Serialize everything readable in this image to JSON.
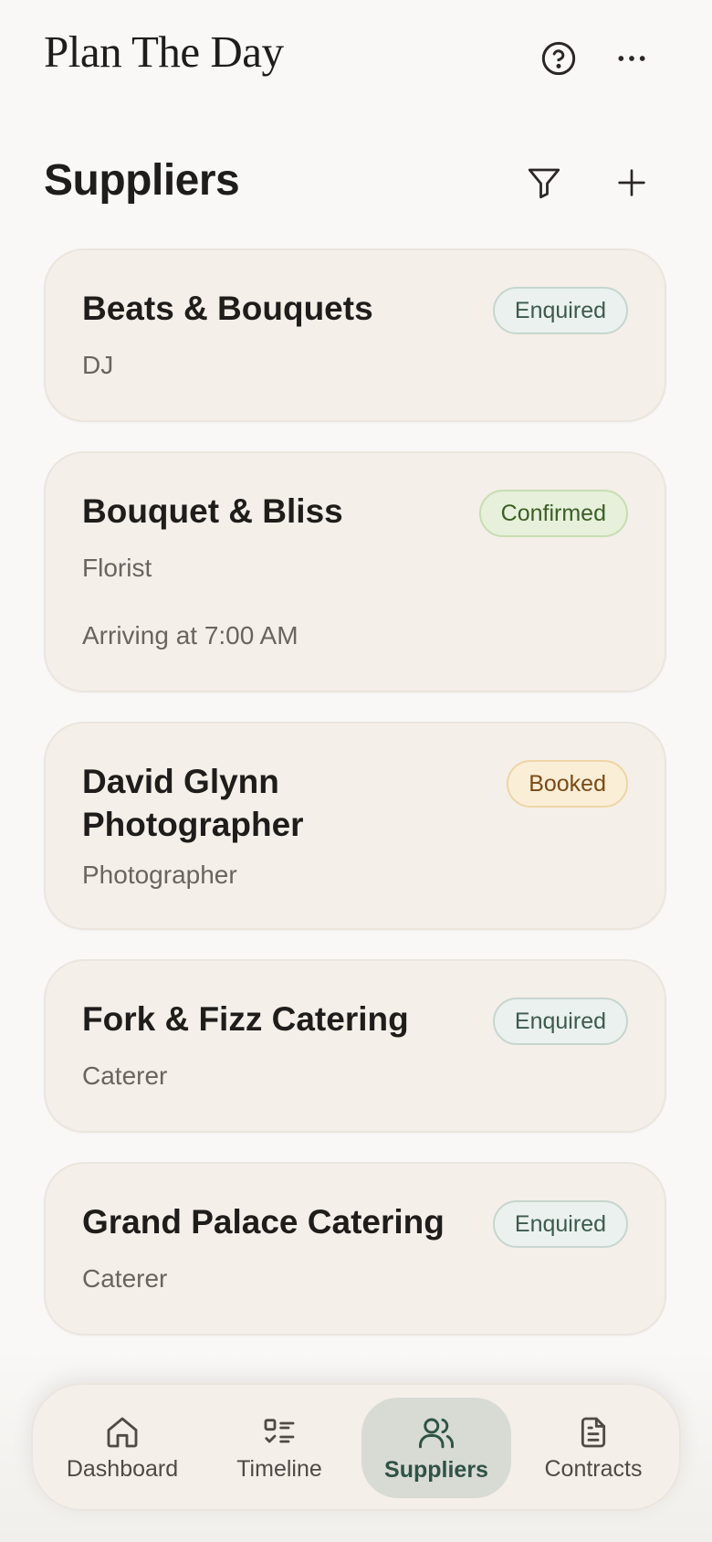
{
  "app": {
    "title": "Plan The Day"
  },
  "section": {
    "title": "Suppliers"
  },
  "suppliers": [
    {
      "name": "Beats & Bouquets",
      "category": "DJ",
      "status": "Enquired",
      "arrival": ""
    },
    {
      "name": "Bouquet & Bliss",
      "category": "Florist",
      "status": "Confirmed",
      "arrival": "Arriving at 7:00 AM"
    },
    {
      "name": "David Glynn Photographer",
      "category": "Photographer",
      "status": "Booked",
      "arrival": ""
    },
    {
      "name": "Fork & Fizz Catering",
      "category": "Caterer",
      "status": "Enquired",
      "arrival": ""
    },
    {
      "name": "Grand Palace Catering",
      "category": "Caterer",
      "status": "Enquired",
      "arrival": ""
    }
  ],
  "nav": {
    "active": "Suppliers",
    "items": [
      {
        "label": "Dashboard",
        "icon": "home-icon"
      },
      {
        "label": "Timeline",
        "icon": "timeline-icon"
      },
      {
        "label": "Suppliers",
        "icon": "users-icon"
      },
      {
        "label": "Contracts",
        "icon": "document-icon"
      }
    ]
  },
  "colors": {
    "background": "#f9f8f6",
    "card": "#f4efe9",
    "accent": "#2f5346",
    "status_enquired": "#eaf1ee",
    "status_confirmed": "#e6f0da",
    "status_booked": "#fbeed7"
  }
}
